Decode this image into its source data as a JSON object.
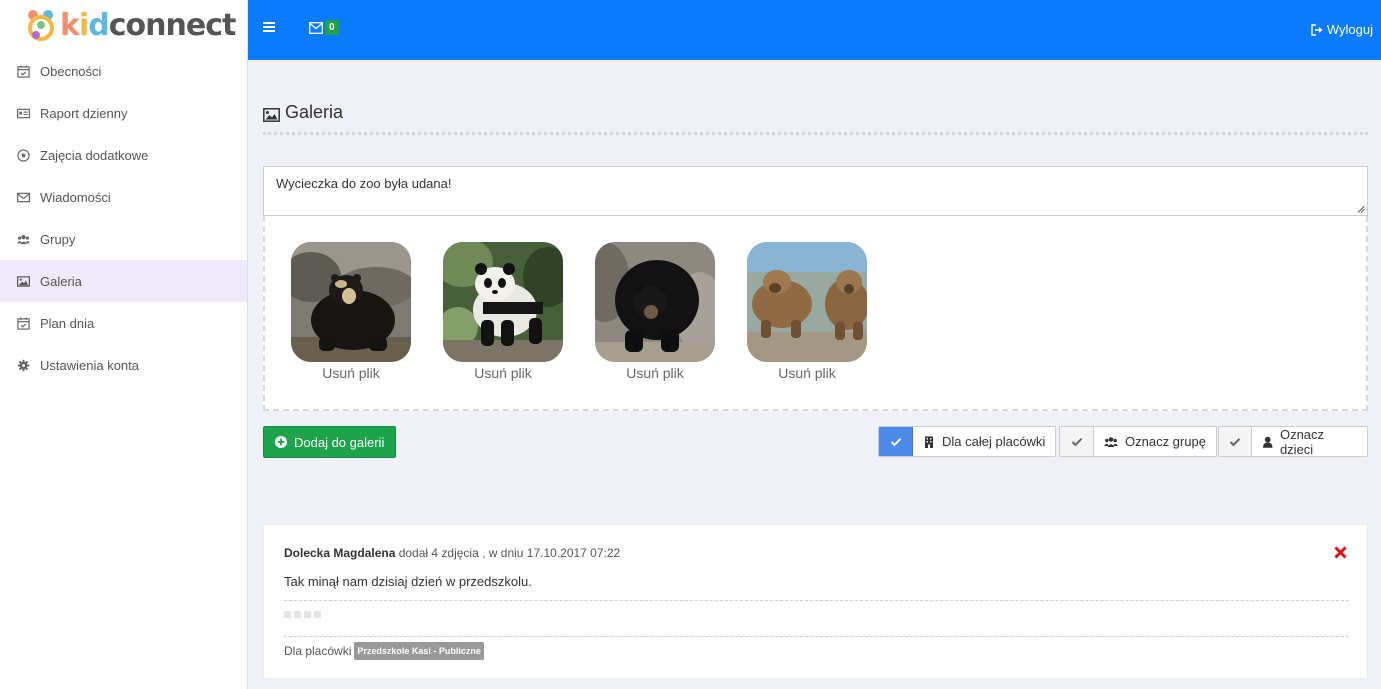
{
  "brand": {
    "part1": "k",
    "part2": "i",
    "part3": "d",
    "part4": "connect"
  },
  "sidebar": {
    "items": [
      {
        "label": "Obecności",
        "icon": "calendar-check-icon"
      },
      {
        "label": "Raport dzienny",
        "icon": "id-card-icon"
      },
      {
        "label": "Zajęcia dodatkowe",
        "icon": "soccer-ball-icon"
      },
      {
        "label": "Wiadomości",
        "icon": "envelope-icon"
      },
      {
        "label": "Grupy",
        "icon": "users-icon"
      },
      {
        "label": "Galeria",
        "icon": "image-icon",
        "active": true
      },
      {
        "label": "Plan dnia",
        "icon": "calendar-check-icon"
      },
      {
        "label": "Ustawienia konta",
        "icon": "gear-icon"
      }
    ]
  },
  "topbar": {
    "mail_count": "0",
    "logout_label": "Wyloguj"
  },
  "page": {
    "title": "Galeria"
  },
  "composer": {
    "text": "Wycieczka do zoo była udana!",
    "thumbnails": [
      {
        "remove_label": "Usuń plik",
        "subject": "spectacled bear"
      },
      {
        "remove_label": "Usuń plik",
        "subject": "giant panda"
      },
      {
        "remove_label": "Usuń plik",
        "subject": "black bear"
      },
      {
        "remove_label": "Usuń plik",
        "subject": "brown bears"
      }
    ],
    "add_button": "Dodaj do galerii",
    "audience": [
      {
        "label": "Dla całej placówki",
        "checked": true,
        "icon": "building-icon"
      },
      {
        "label": "Oznacz grupę",
        "checked": false,
        "icon": "users-icon"
      },
      {
        "label": "Oznacz dzieci",
        "checked": false,
        "icon": "user-icon"
      }
    ]
  },
  "post": {
    "author": "Dolecka Magdalena",
    "meta": " dodał 4 zdjęcia , w dniu 17.10.2017 07:22",
    "text": "Tak minął nam dzisiaj dzień w przedszkolu.",
    "footer_label": "Dla placówki",
    "tag": "Przedszkole Kasi - Publiczne"
  },
  "colors": {
    "topbar": "#0a7afe",
    "add_button": "#1ea34d",
    "active_nav": "#efe9fb",
    "checked": "#4a8ae8",
    "delete": "#e01010"
  }
}
